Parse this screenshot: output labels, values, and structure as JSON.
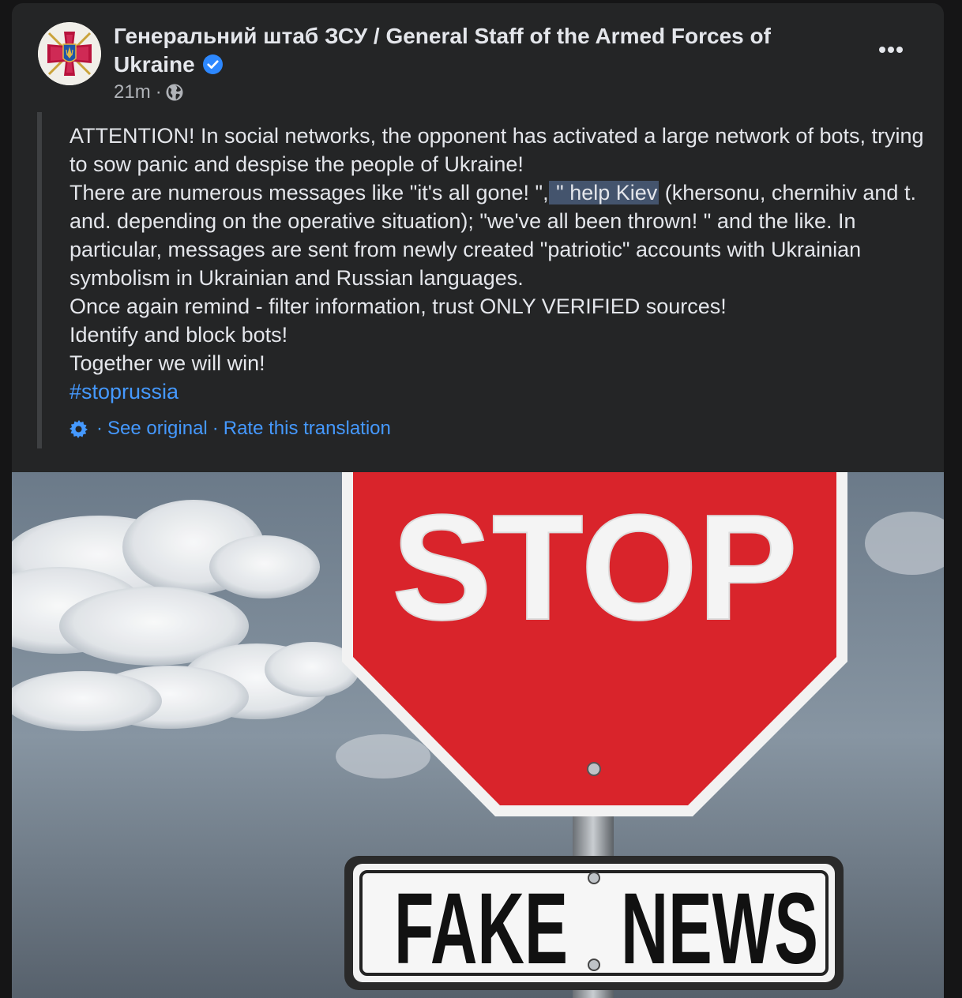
{
  "post": {
    "author": "Генеральний штаб ЗСУ / General Staff of the Armed Forces of Ukraine",
    "time": "21m",
    "meta_separator": "·",
    "privacy_icon": "globe-icon",
    "verified_icon": "verified-badge-icon",
    "lines": {
      "l1": "ATTENTION! In social networks, the opponent has activated a large network of bots, trying to sow panic and despise the people of Ukraine!",
      "l2_before": "There are numerous messages like \"it's all gone! \",",
      "l2_highlight": " \" help Kiev",
      "l2_after": " (khersonu, chernihiv and t. and. depending on the operative situation); \"we've all been thrown! \" and the like. In particular, messages are sent from newly created \"patriotic\" accounts with Ukrainian symbolism in Ukrainian and Russian languages.",
      "l3": "Once again remind - filter information, trust ONLY VERIFIED sources!",
      "l4": "Identify and block bots!",
      "l5": "Together we will win!",
      "hashtag": "#stoprussia"
    },
    "translation": {
      "separator": "·",
      "see_original": "See original",
      "rate": "Rate this translation"
    },
    "image": {
      "sign_top": "STOP",
      "sign_bottom_left": "FAKE",
      "sign_bottom_right": "NEWS"
    }
  },
  "colors": {
    "card": "#242526",
    "text": "#e4e6eb",
    "secondary": "#b0b3b8",
    "link": "#4599ff",
    "verified": "#2d88ff",
    "stop_red": "#d9242b"
  }
}
